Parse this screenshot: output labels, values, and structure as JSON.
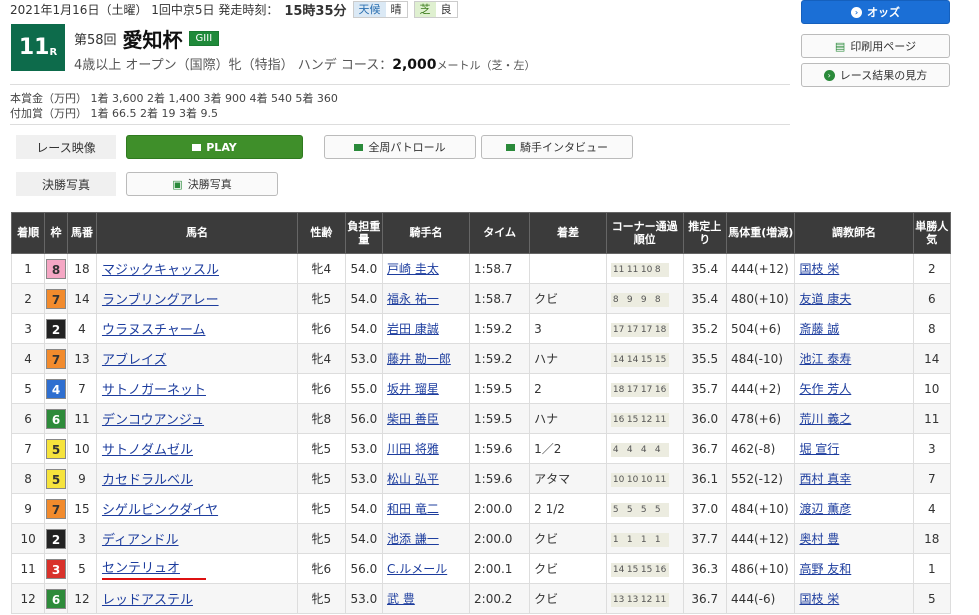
{
  "header": {
    "date": "2021年1月16日（土曜） 1回中京5日 発走時刻：",
    "time": "15時35分",
    "weather_label": "天候",
    "weather": "晴",
    "track_label": "芝",
    "track": "良"
  },
  "race": {
    "no": "11",
    "r": "R",
    "kai": "第58回",
    "name": "愛知杯",
    "grade": "GIII",
    "cond": "4歳以上 オープン（国際）牝（特指） ハンデ コース：",
    "dist": "2,000",
    "unit": "メートル（芝・左）"
  },
  "prize1": "本賞金（万円） 1着 3,600 2着 1,400 3着 900 4着 540 5着 360",
  "prize2": "付加賞（万円） 1着 66.5 2着 19 3着 9.5",
  "buttons": {
    "odds": "オッズ",
    "print": "印刷用ページ",
    "howto": "レース結果の見方"
  },
  "video": {
    "label": "レース映像",
    "play": "PLAY",
    "patrol": "全周パトロール",
    "interview": "騎手インタビュー"
  },
  "photo": {
    "label": "決勝写真",
    "btn": "決勝写真"
  },
  "headers": [
    "着順",
    "枠",
    "馬番",
    "馬名",
    "性齢",
    "負担重量",
    "騎手名",
    "タイム",
    "着差",
    "コーナー通過順位",
    "推定上り",
    "馬体重(増減)",
    "調教師名",
    "単勝人気"
  ],
  "rows": [
    {
      "rank": "1",
      "waku": "8",
      "num": "18",
      "name": "マジックキャッスル",
      "sex": "牝4",
      "wt": "54.0",
      "jockey": "戸崎 圭太",
      "time": "1:58.7",
      "diff": "",
      "c": [
        "11",
        "11",
        "10",
        "8"
      ],
      "agari": "35.4",
      "bw": "444(+12)",
      "trainer": "国枝 栄",
      "pop": "2"
    },
    {
      "rank": "2",
      "waku": "7",
      "num": "14",
      "name": "ランブリングアレー",
      "sex": "牝5",
      "wt": "54.0",
      "jockey": "福永 祐一",
      "time": "1:58.7",
      "diff": "クビ",
      "c": [
        "8",
        "9",
        "9",
        "8"
      ],
      "agari": "35.4",
      "bw": "480(+10)",
      "trainer": "友道 康夫",
      "pop": "6"
    },
    {
      "rank": "3",
      "waku": "2",
      "num": "4",
      "name": "ウラヌスチャーム",
      "sex": "牝6",
      "wt": "54.0",
      "jockey": "岩田 康誠",
      "time": "1:59.2",
      "diff": "3",
      "c": [
        "17",
        "17",
        "17",
        "18"
      ],
      "agari": "35.2",
      "bw": "504(+6)",
      "trainer": "斎藤 誠",
      "pop": "8"
    },
    {
      "rank": "4",
      "waku": "7",
      "num": "13",
      "name": "アブレイズ",
      "sex": "牝4",
      "wt": "53.0",
      "jockey": "藤井 勘一郎",
      "time": "1:59.2",
      "diff": "ハナ",
      "c": [
        "14",
        "14",
        "15",
        "15"
      ],
      "agari": "35.5",
      "bw": "484(-10)",
      "trainer": "池江 泰寿",
      "pop": "14"
    },
    {
      "rank": "5",
      "waku": "4",
      "num": "7",
      "name": "サトノガーネット",
      "sex": "牝6",
      "wt": "55.0",
      "jockey": "坂井 瑠星",
      "time": "1:59.5",
      "diff": "2",
      "c": [
        "18",
        "17",
        "17",
        "16"
      ],
      "agari": "35.7",
      "bw": "444(+2)",
      "trainer": "矢作 芳人",
      "pop": "10"
    },
    {
      "rank": "6",
      "waku": "6",
      "num": "11",
      "name": "デンコウアンジュ",
      "sex": "牝8",
      "wt": "56.0",
      "jockey": "柴田 善臣",
      "time": "1:59.5",
      "diff": "ハナ",
      "c": [
        "16",
        "15",
        "12",
        "11"
      ],
      "agari": "36.0",
      "bw": "478(+6)",
      "trainer": "荒川 義之",
      "pop": "11"
    },
    {
      "rank": "7",
      "waku": "5",
      "num": "10",
      "name": "サトノダムゼル",
      "sex": "牝5",
      "wt": "53.0",
      "jockey": "川田 将雅",
      "time": "1:59.6",
      "diff": "1／2",
      "c": [
        "4",
        "4",
        "4",
        "4"
      ],
      "agari": "36.7",
      "bw": "462(-8)",
      "trainer": "堀 宣行",
      "pop": "3"
    },
    {
      "rank": "8",
      "waku": "5",
      "num": "9",
      "name": "カセドラルベル",
      "sex": "牝5",
      "wt": "53.0",
      "jockey": "松山 弘平",
      "time": "1:59.6",
      "diff": "アタマ",
      "c": [
        "10",
        "10",
        "10",
        "11"
      ],
      "agari": "36.1",
      "bw": "552(-12)",
      "trainer": "西村 真幸",
      "pop": "7"
    },
    {
      "rank": "9",
      "waku": "7",
      "num": "15",
      "name": "シゲルピンクダイヤ",
      "sex": "牝5",
      "wt": "54.0",
      "jockey": "和田 竜二",
      "time": "2:00.0",
      "diff": "2 1/2",
      "c": [
        "5",
        "5",
        "5",
        "5"
      ],
      "agari": "37.0",
      "bw": "484(+10)",
      "trainer": "渡辺 薫彦",
      "pop": "4"
    },
    {
      "rank": "10",
      "waku": "2",
      "num": "3",
      "name": "ディアンドル",
      "sex": "牝5",
      "wt": "54.0",
      "jockey": "池添 謙一",
      "time": "2:00.0",
      "diff": "クビ",
      "c": [
        "1",
        "1",
        "1",
        "1"
      ],
      "agari": "37.7",
      "bw": "444(+12)",
      "trainer": "奥村 豊",
      "pop": "18"
    },
    {
      "rank": "11",
      "waku": "3",
      "num": "5",
      "name": "センテリュオ",
      "sex": "牝6",
      "wt": "56.0",
      "jockey": "C.ルメール",
      "time": "2:00.1",
      "diff": "クビ",
      "c": [
        "14",
        "15",
        "15",
        "16"
      ],
      "agari": "36.3",
      "bw": "486(+10)",
      "trainer": "高野 友和",
      "pop": "1"
    },
    {
      "rank": "12",
      "waku": "6",
      "num": "12",
      "name": "レッドアステル",
      "sex": "牝5",
      "wt": "53.0",
      "jockey": "武 豊",
      "time": "2:00.2",
      "diff": "クビ",
      "c": [
        "13",
        "13",
        "12",
        "11"
      ],
      "agari": "36.7",
      "bw": "444(-6)",
      "trainer": "国枝 栄",
      "pop": "5"
    }
  ],
  "waku_colors": {
    "1": [
      "#ffffff",
      "#333"
    ],
    "2": [
      "#222222",
      "#fff"
    ],
    "3": [
      "#d9322b",
      "#fff"
    ],
    "4": [
      "#2f6fd0",
      "#fff"
    ],
    "5": [
      "#f6e33c",
      "#333"
    ],
    "6": [
      "#2e8b3a",
      "#fff"
    ],
    "7": [
      "#f28b2d",
      "#333"
    ],
    "8": [
      "#f5a7c4",
      "#333"
    ]
  }
}
